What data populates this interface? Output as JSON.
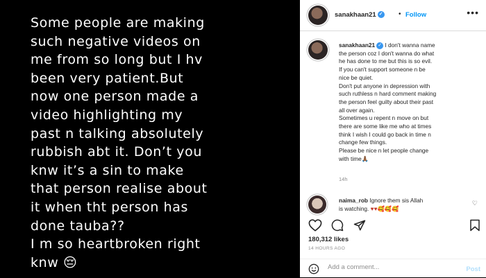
{
  "story": {
    "text": "Some people are making\nsuch negative videos on\nme from so long but I hv\nbeen very patient.But\nnow one person made a\nvideo highlighting my\npast n talking absolutely\nrubbish abt it. Don’t you\nknw it’s a sin to make\nthat person realise about\nit when tht person has\ndone tauba??\nI m so heartbroken right\nknw 😔"
  },
  "post": {
    "username": "sanakhaan21",
    "separator": "•",
    "follow_label": "Follow",
    "more_label": "•••",
    "caption_lines": [
      "I don't wanna name",
      "the person coz I don't wanna do what",
      "he has done to me but this is so evil.",
      "If you can't support someone n be",
      "nice be quiet.",
      "Don't put anyone in depression with",
      "such ruthless n hard comment making",
      "the person feel guilty about their past",
      "all over again.",
      "Sometimes u repent n move on but",
      "there are some like me who at times",
      "think I wish I could go back in time n",
      "change few things.",
      "Please be nice n let people change",
      "with time🙏🏾"
    ],
    "caption_time": "14h",
    "comment": {
      "username": "naima_rob",
      "text_line1": "Ignore them sis Allah",
      "text_line2": "is watching.",
      "emojis": "♥♥🥰🥰🥰"
    },
    "likes": "180,312 likes",
    "time_ago": "14 HOURS AGO",
    "add_comment_placeholder": "Add a comment...",
    "post_label": "Post"
  },
  "colors": {
    "accent": "#0095f6",
    "verified": "#3897f0",
    "post_disabled": "#b2dffc",
    "muted": "#8e8e8e"
  },
  "icons": {
    "header": [
      "avatar",
      "verified-icon",
      "more-icon"
    ],
    "actions": [
      "heart-icon",
      "comment-icon",
      "share-icon",
      "bookmark-icon"
    ],
    "comment_bar": [
      "emoji-icon"
    ]
  }
}
